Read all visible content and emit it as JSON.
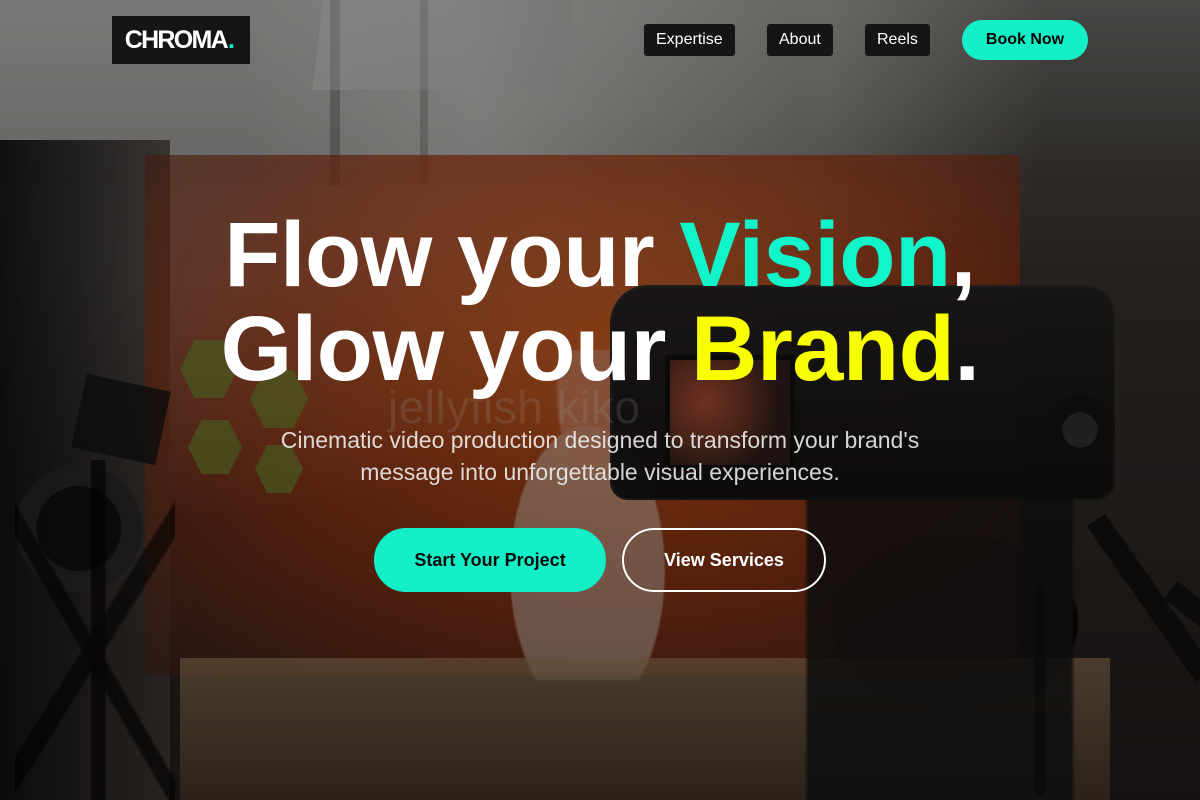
{
  "brand": {
    "name": "CHROMA",
    "dot": ".",
    "accent": "#13f0c7"
  },
  "nav": {
    "items": [
      {
        "label": "Expertise"
      },
      {
        "label": "About"
      },
      {
        "label": "Reels"
      }
    ],
    "book_button": "Book Now"
  },
  "hero": {
    "headline_line1": {
      "prefix": "Flow your ",
      "highlight": "Vision",
      "suffix": ","
    },
    "headline_line2": {
      "prefix": "Glow your ",
      "highlight": "Brand",
      "suffix": "."
    },
    "subtitle": "Cinematic video production designed to transform your brand's message into unforgettable visual experiences.",
    "primary_button": "Start Your Project",
    "secondary_button": "View Services",
    "background_watermark": "jellyfish kiko",
    "colors": {
      "teal": "#11f5cb",
      "yellow": "#f8ff00",
      "text": "#ffffff"
    }
  }
}
